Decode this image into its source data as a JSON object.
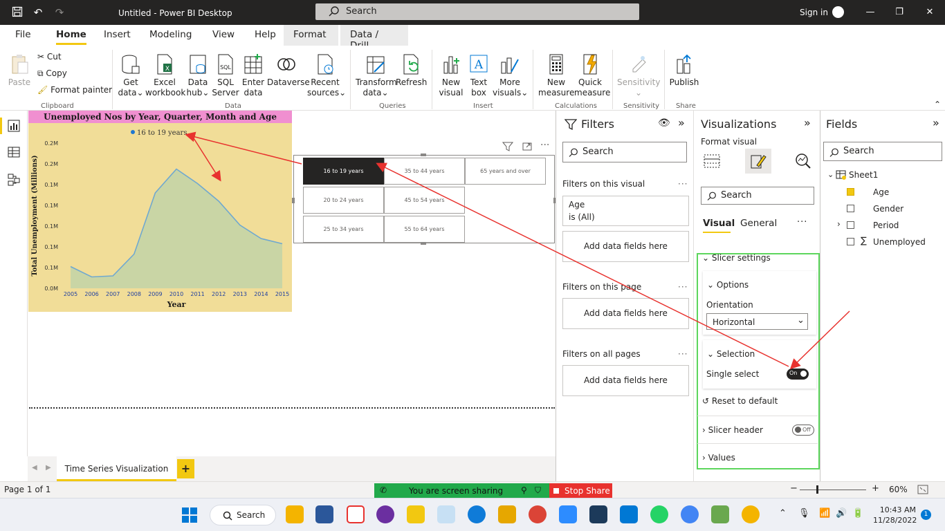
{
  "titlebar": {
    "title": "Untitled - Power BI Desktop",
    "search_placeholder": "Search",
    "signin": "Sign in",
    "window_controls": [
      "minimize-icon",
      "restore-icon",
      "close-icon"
    ]
  },
  "menu": {
    "tabs": [
      "File",
      "Home",
      "Insert",
      "Modeling",
      "View",
      "Help",
      "Format",
      "Data / Drill"
    ],
    "active": "Home"
  },
  "ribbon": {
    "clipboard": {
      "paste": "Paste",
      "cut": "Cut",
      "copy": "Copy",
      "format_painter": "Format painter",
      "group": "Clipboard"
    },
    "data": {
      "get_data": [
        "Get",
        "data"
      ],
      "excel": [
        "Excel",
        "workbook"
      ],
      "data_hub": [
        "Data",
        "hub"
      ],
      "sql": [
        "SQL",
        "Server"
      ],
      "enter": [
        "Enter",
        "data"
      ],
      "dataverse": "Dataverse",
      "recent": [
        "Recent",
        "sources"
      ],
      "group": "Data"
    },
    "queries": {
      "transform": [
        "Transform",
        "data"
      ],
      "refresh": "Refresh",
      "group": "Queries"
    },
    "insert": {
      "new_visual": [
        "New",
        "visual"
      ],
      "text_box": [
        "Text",
        "box"
      ],
      "more_visuals": [
        "More",
        "visuals"
      ],
      "group": "Insert"
    },
    "calculations": {
      "new_measure": [
        "New",
        "measure"
      ],
      "quick_measure": [
        "Quick",
        "measure"
      ],
      "group": "Calculations"
    },
    "sensitivity": {
      "label": "Sensitivity",
      "group": "Sensitivity"
    },
    "share": {
      "publish": "Publish",
      "group": "Share"
    }
  },
  "chart": {
    "title": "Unemployed Nos by Year, Quarter, Month and Age",
    "legend": "16 to 19 years",
    "ylabel": "Total Unemployment (Millions)",
    "xlabel": "Year",
    "colors": {
      "area_fill": "#c9d5a5",
      "line": "#6fa8d0",
      "legend_dot": "#1f77d0",
      "background": "#f1dd98",
      "title_bg": "#f08fd0"
    }
  },
  "chart_data": {
    "type": "area",
    "title": "Unemployed Nos by Year, Quarter, Month and Age",
    "xlabel": "Year",
    "ylabel": "Total Unemployment (Millions)",
    "x": [
      2005,
      2006,
      2007,
      2008,
      2009,
      2010,
      2011,
      2012,
      2013,
      2014,
      2015
    ],
    "y_tick_labels": [
      "0.2M",
      "0.2M",
      "0.1M",
      "0.1M",
      "0.1M",
      "0.1M",
      "0.1M",
      "0.0M"
    ],
    "y_tick_values": [
      0.14,
      0.12,
      0.1,
      0.08,
      0.06,
      0.04,
      0.02,
      0.0
    ],
    "series": [
      {
        "name": "16 to 19 years",
        "values": [
          0.021,
          0.011,
          0.012,
          0.033,
          0.092,
          0.115,
          0.101,
          0.084,
          0.061,
          0.048,
          0.043
        ]
      }
    ],
    "ylim": [
      0,
      0.14
    ],
    "grid": false,
    "legend_position": "top"
  },
  "slicer": {
    "items": [
      "16 to 19 years",
      "35 to 44 years",
      "65 years and over",
      "20 to 24 years",
      "45 to 54 years",
      "25 to 34 years",
      "55 to 64 years"
    ],
    "selected": "16 to 19 years"
  },
  "page_tabs": {
    "tab1": "Time Series Visualization",
    "add": "+"
  },
  "status": {
    "page": "Page 1 of 1",
    "sharing": "You are screen sharing",
    "stop_share": "Stop Share",
    "zoom": "60%",
    "minus": "−",
    "plus": "+"
  },
  "filters": {
    "title": "Filters",
    "search": "Search",
    "on_visual": "Filters on this visual",
    "age_card": {
      "field": "Age",
      "value": "is (All)"
    },
    "add_here": "Add data fields here",
    "on_page": "Filters on this page",
    "on_all": "Filters on all pages",
    "more": "···"
  },
  "viz": {
    "title": "Visualizations",
    "format_visual": "Format visual",
    "search": "Search",
    "tabs": [
      "Visual",
      "General"
    ],
    "more": "···",
    "slicer_settings": "Slicer settings",
    "options": "Options",
    "orientation_label": "Orientation",
    "orientation_value": "Horizontal",
    "selection": "Selection",
    "single_select": "Single select",
    "single_select_state": "On",
    "reset": "Reset to default",
    "slicer_header": "Slicer header",
    "slicer_header_state": "Off",
    "values": "Values",
    "highlight_color": "#5cd65c"
  },
  "fields": {
    "title": "Fields",
    "search": "Search",
    "table": "Sheet1",
    "items": [
      {
        "name": "Age",
        "checked": true
      },
      {
        "name": "Gender",
        "checked": false
      },
      {
        "name": "Period",
        "checked": false
      },
      {
        "name": "Unemployed",
        "checked": false
      }
    ]
  },
  "taskbar": {
    "search": "Search",
    "time": "10:43 AM",
    "date": "11/28/2022",
    "notifications": "1"
  },
  "annotation_color": "#e8322e",
  "accent": "#f2c811"
}
